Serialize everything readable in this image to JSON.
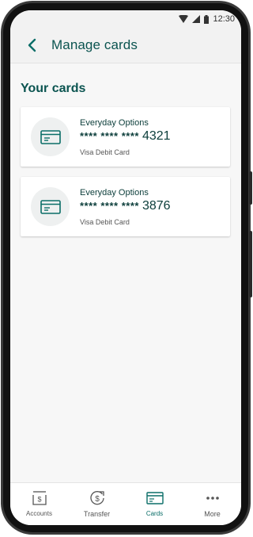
{
  "status_bar": {
    "time": "12:30"
  },
  "header": {
    "title": "Manage cards",
    "back_icon": "chevron-left-icon"
  },
  "section": {
    "title": "Your cards"
  },
  "cards": [
    {
      "name": "Everyday Options",
      "masked": "**** **** ****",
      "last4": "4321",
      "type": "Visa Debit Card",
      "icon": "credit-card-icon"
    },
    {
      "name": "Everyday Options",
      "masked": "**** **** ****",
      "last4": "3876",
      "type": "Visa Debit Card",
      "icon": "credit-card-icon"
    }
  ],
  "bottom_nav": {
    "items": [
      {
        "label": "Accounts",
        "icon": "accounts-icon",
        "active": false
      },
      {
        "label": "Transfer",
        "icon": "transfer-icon",
        "active": false
      },
      {
        "label": "Cards",
        "icon": "cards-icon",
        "active": true
      },
      {
        "label": "More",
        "icon": "more-icon",
        "active": false
      }
    ]
  },
  "colors": {
    "primary": "#0b5450",
    "accent": "#0b6e68",
    "background": "#f7f7f7"
  }
}
